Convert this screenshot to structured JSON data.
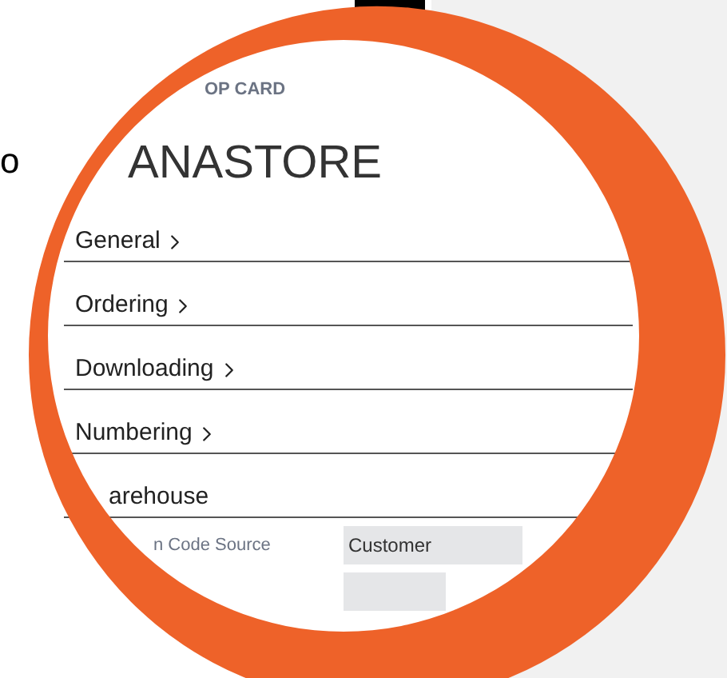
{
  "side_text": "o",
  "card": {
    "caption": "OP CARD",
    "title": "ANASTORE",
    "sections": [
      {
        "label": "General",
        "expandable": true
      },
      {
        "label": "Ordering",
        "expandable": true
      },
      {
        "label": "Downloading",
        "expandable": true
      },
      {
        "label": "Numbering",
        "expandable": true
      },
      {
        "label": "arehouse",
        "expandable": false
      }
    ],
    "fields": [
      {
        "label": "n Code Source",
        "value": "Customer"
      }
    ],
    "empty_field": true
  }
}
